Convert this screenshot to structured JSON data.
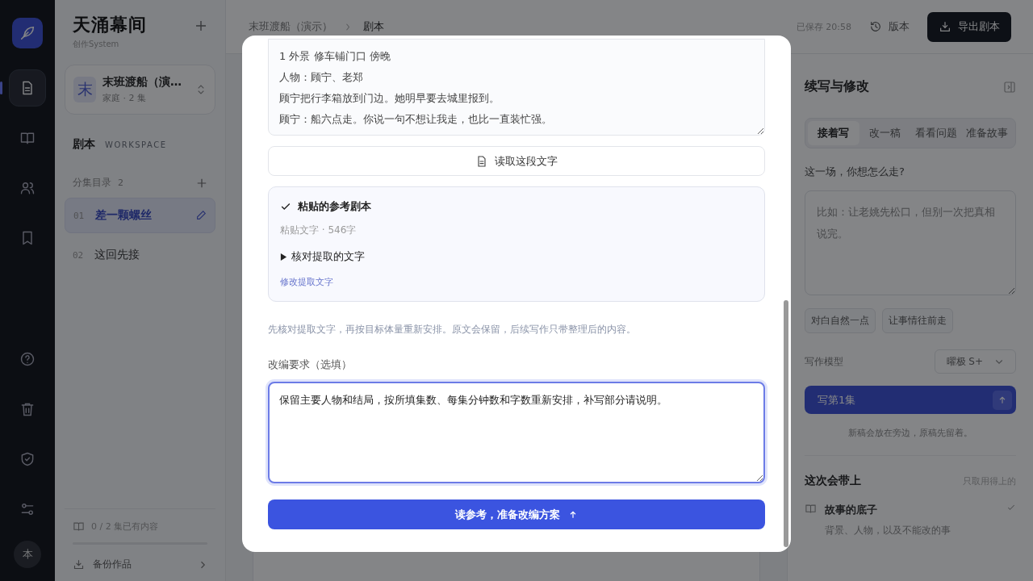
{
  "rail": {
    "nav_items": [
      {
        "kind": "document",
        "selected": true
      },
      {
        "kind": "book",
        "selected": false
      },
      {
        "kind": "people",
        "selected": false
      },
      {
        "kind": "bookmark",
        "selected": false
      }
    ],
    "avatar": "本"
  },
  "sidebar": {
    "title": "天涌幕间",
    "subtitle": "创作System",
    "project": {
      "initial": "末",
      "name": "末班渡船（演…",
      "meta": "家庭 · 2 集"
    },
    "section": "剧本",
    "section_tag": "WORKSPACE",
    "episodes_label": "分集目录",
    "episodes_count": "2",
    "episodes": [
      {
        "number": "01",
        "title": "差一颗螺丝",
        "selected": true
      },
      {
        "number": "02",
        "title": "这回先接",
        "selected": false
      }
    ],
    "progress": "0 / 2 集已有内容",
    "backup": "备份作品"
  },
  "header": {
    "breadcrumb": [
      "末班渡船（演示）",
      "剧本"
    ],
    "saved": "已保存 20:58",
    "versions": "版本",
    "export": "导出剧本"
  },
  "panel": {
    "title": "续写与修改",
    "tabs": [
      {
        "label": "接着写",
        "selected": true
      },
      {
        "label": "改一稿",
        "selected": false
      },
      {
        "label": "看看问题",
        "selected": false
      },
      {
        "label": "准备故事",
        "selected": false
      }
    ],
    "prompt_label": "这一场，你想怎么走?",
    "prompt_placeholder": "比如：让老姚先松口，但别一次把真相说完。",
    "chips": [
      "对白自然一点",
      "让事情往前走"
    ],
    "model_label": "写作模型",
    "model": "曜极 S+",
    "write_button": "写第1集",
    "note": "新稿会放在旁边，原稿先留着。",
    "context_title": "这次会带上",
    "context_hint": "只取用得上的",
    "context_items": [
      {
        "title": "故事的底子",
        "desc": "背景、人物，以及不能改的事",
        "checked": true
      }
    ]
  },
  "modal": {
    "script_lines": [
      "1 外景 修车铺门口 傍晚",
      "人物：顾宁、老郑",
      "顾宁把行李箱放到门边。她明早要去城里报到。",
      "顾宁：船六点走。你说一句不想让我走，也比一直装忙强。"
    ],
    "read_button": "读取这段文字",
    "source": {
      "title": "粘贴的参考剧本",
      "checked": true,
      "meta": "粘贴文字 · 546字",
      "disclosure": "核对提取的文字",
      "expanded": false,
      "edit_link": "修改提取文字"
    },
    "hint": "先核对提取文字，再按目标体量重新安排。原文会保留，后续写作只带整理后的内容。",
    "requirement_label": "改编要求（选填）",
    "requirement_value": "保留主要人物和结局，按所填集数、每集分钟数和字数重新安排，补写部分请说明。",
    "submit": "读参考，准备改编方案"
  }
}
